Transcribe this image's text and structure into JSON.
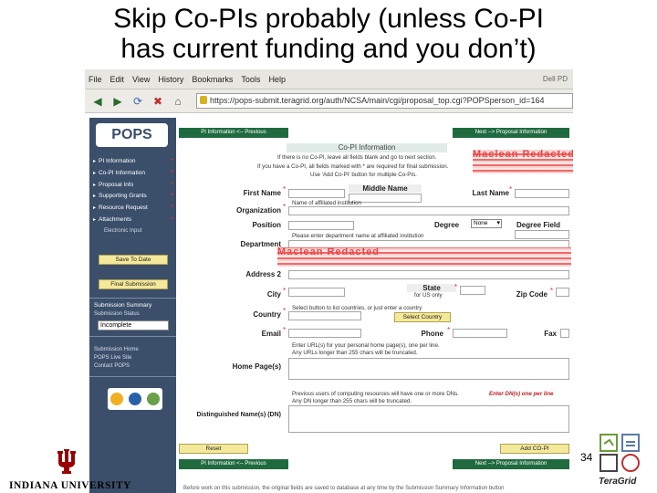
{
  "slide": {
    "title_line1": "Skip Co-PIs probably (unless Co-PI",
    "title_line2": "has current funding and you don’t)",
    "page_number": "34",
    "left_logo_text": "INDIANA UNIVERSITY",
    "right_logo_text": "TeraGrid"
  },
  "browser": {
    "menu": [
      "File",
      "Edit",
      "View",
      "History",
      "Bookmarks",
      "Tools",
      "Help"
    ],
    "sysinfo": "Dell PD",
    "url": "https://pops-submit.teragrid.org/auth/NCSA/main/cgi/proposal_top.cgi?POPSperson_id=164"
  },
  "sidebar": {
    "logo": "POPS",
    "items": [
      {
        "label": "PI Information",
        "required": true
      },
      {
        "label": "Co-PI Information",
        "required": true
      },
      {
        "label": "Proposal Info",
        "required": true
      },
      {
        "label": "Supporting Grants",
        "required": true
      },
      {
        "label": "Resource Request",
        "required": true
      },
      {
        "label": "Attachments",
        "required": true
      }
    ],
    "sub_item": "Electronic Input",
    "save_button": "Save To Date",
    "final_button": "Final Submission",
    "submission_summary": "Submission Summary",
    "submission_status_label": "Submission Status",
    "submission_status": "Incomplete",
    "links": [
      "Submission Home",
      "POPS Live Site",
      "Contact POPS"
    ]
  },
  "form": {
    "prev_button": "PI Information <-- Previous",
    "next_button": "Next --> Proposal Information",
    "section_title": "Co-PI Information",
    "intro_lines": [
      "If there is no Co-PI, leave all fields blank and go to next section.",
      "If you have a Co-PI, all fields marked with * are required for final submission.",
      "Use 'Add Co-PI' button for multiple Co-PIs."
    ],
    "labels": {
      "first_name": "First Name",
      "middle_name": "Middle Name",
      "last_name": "Last Name",
      "organization": "Organization",
      "position": "Position",
      "degree": "Degree",
      "degree_field": "Degree Field",
      "department": "Department",
      "address2": "Address 2",
      "city": "City",
      "state": "State",
      "zip": "Zip Code",
      "country": "Country",
      "email": "Email",
      "phone": "Phone",
      "fax": "Fax",
      "home_pages": "Home Page(s)",
      "dn": "Distinguished Name(s) (DN)"
    },
    "org_hint": "Name of affiliated institution",
    "degree_value": "None",
    "department_hint": "Please enter department name at affiliated institution",
    "state_hint": "for US only",
    "country_hint": "Select button to list countries, or just enter a country",
    "select_country_button": "Select Country",
    "homepage_hint_lines": [
      "Enter URL(s) for your personal home page(s), one per line.",
      "Any URLs longer than 255 chars will be truncated."
    ],
    "dn_hint_lines": [
      "Previous users of computing resources will have one or more DNs.",
      "Any DN longer than 255 chars will be truncated."
    ],
    "dn_hint_red": "Enter DN(s) one per line",
    "reset_button": "Reset",
    "add_copi_button": "Add CO-PI",
    "redaction_text": "Maclean Redacted",
    "footer_text": "Before work on this submission, the original fields are saved to database at any time by the Submission Summary Information button"
  },
  "colors": {
    "sidebar_bg": "#3b4f6b",
    "nav_green": "#1f6b3f",
    "button_yellow": "#f4e99a",
    "required_red": "#e03030",
    "redaction_red": "#f06a6a"
  }
}
